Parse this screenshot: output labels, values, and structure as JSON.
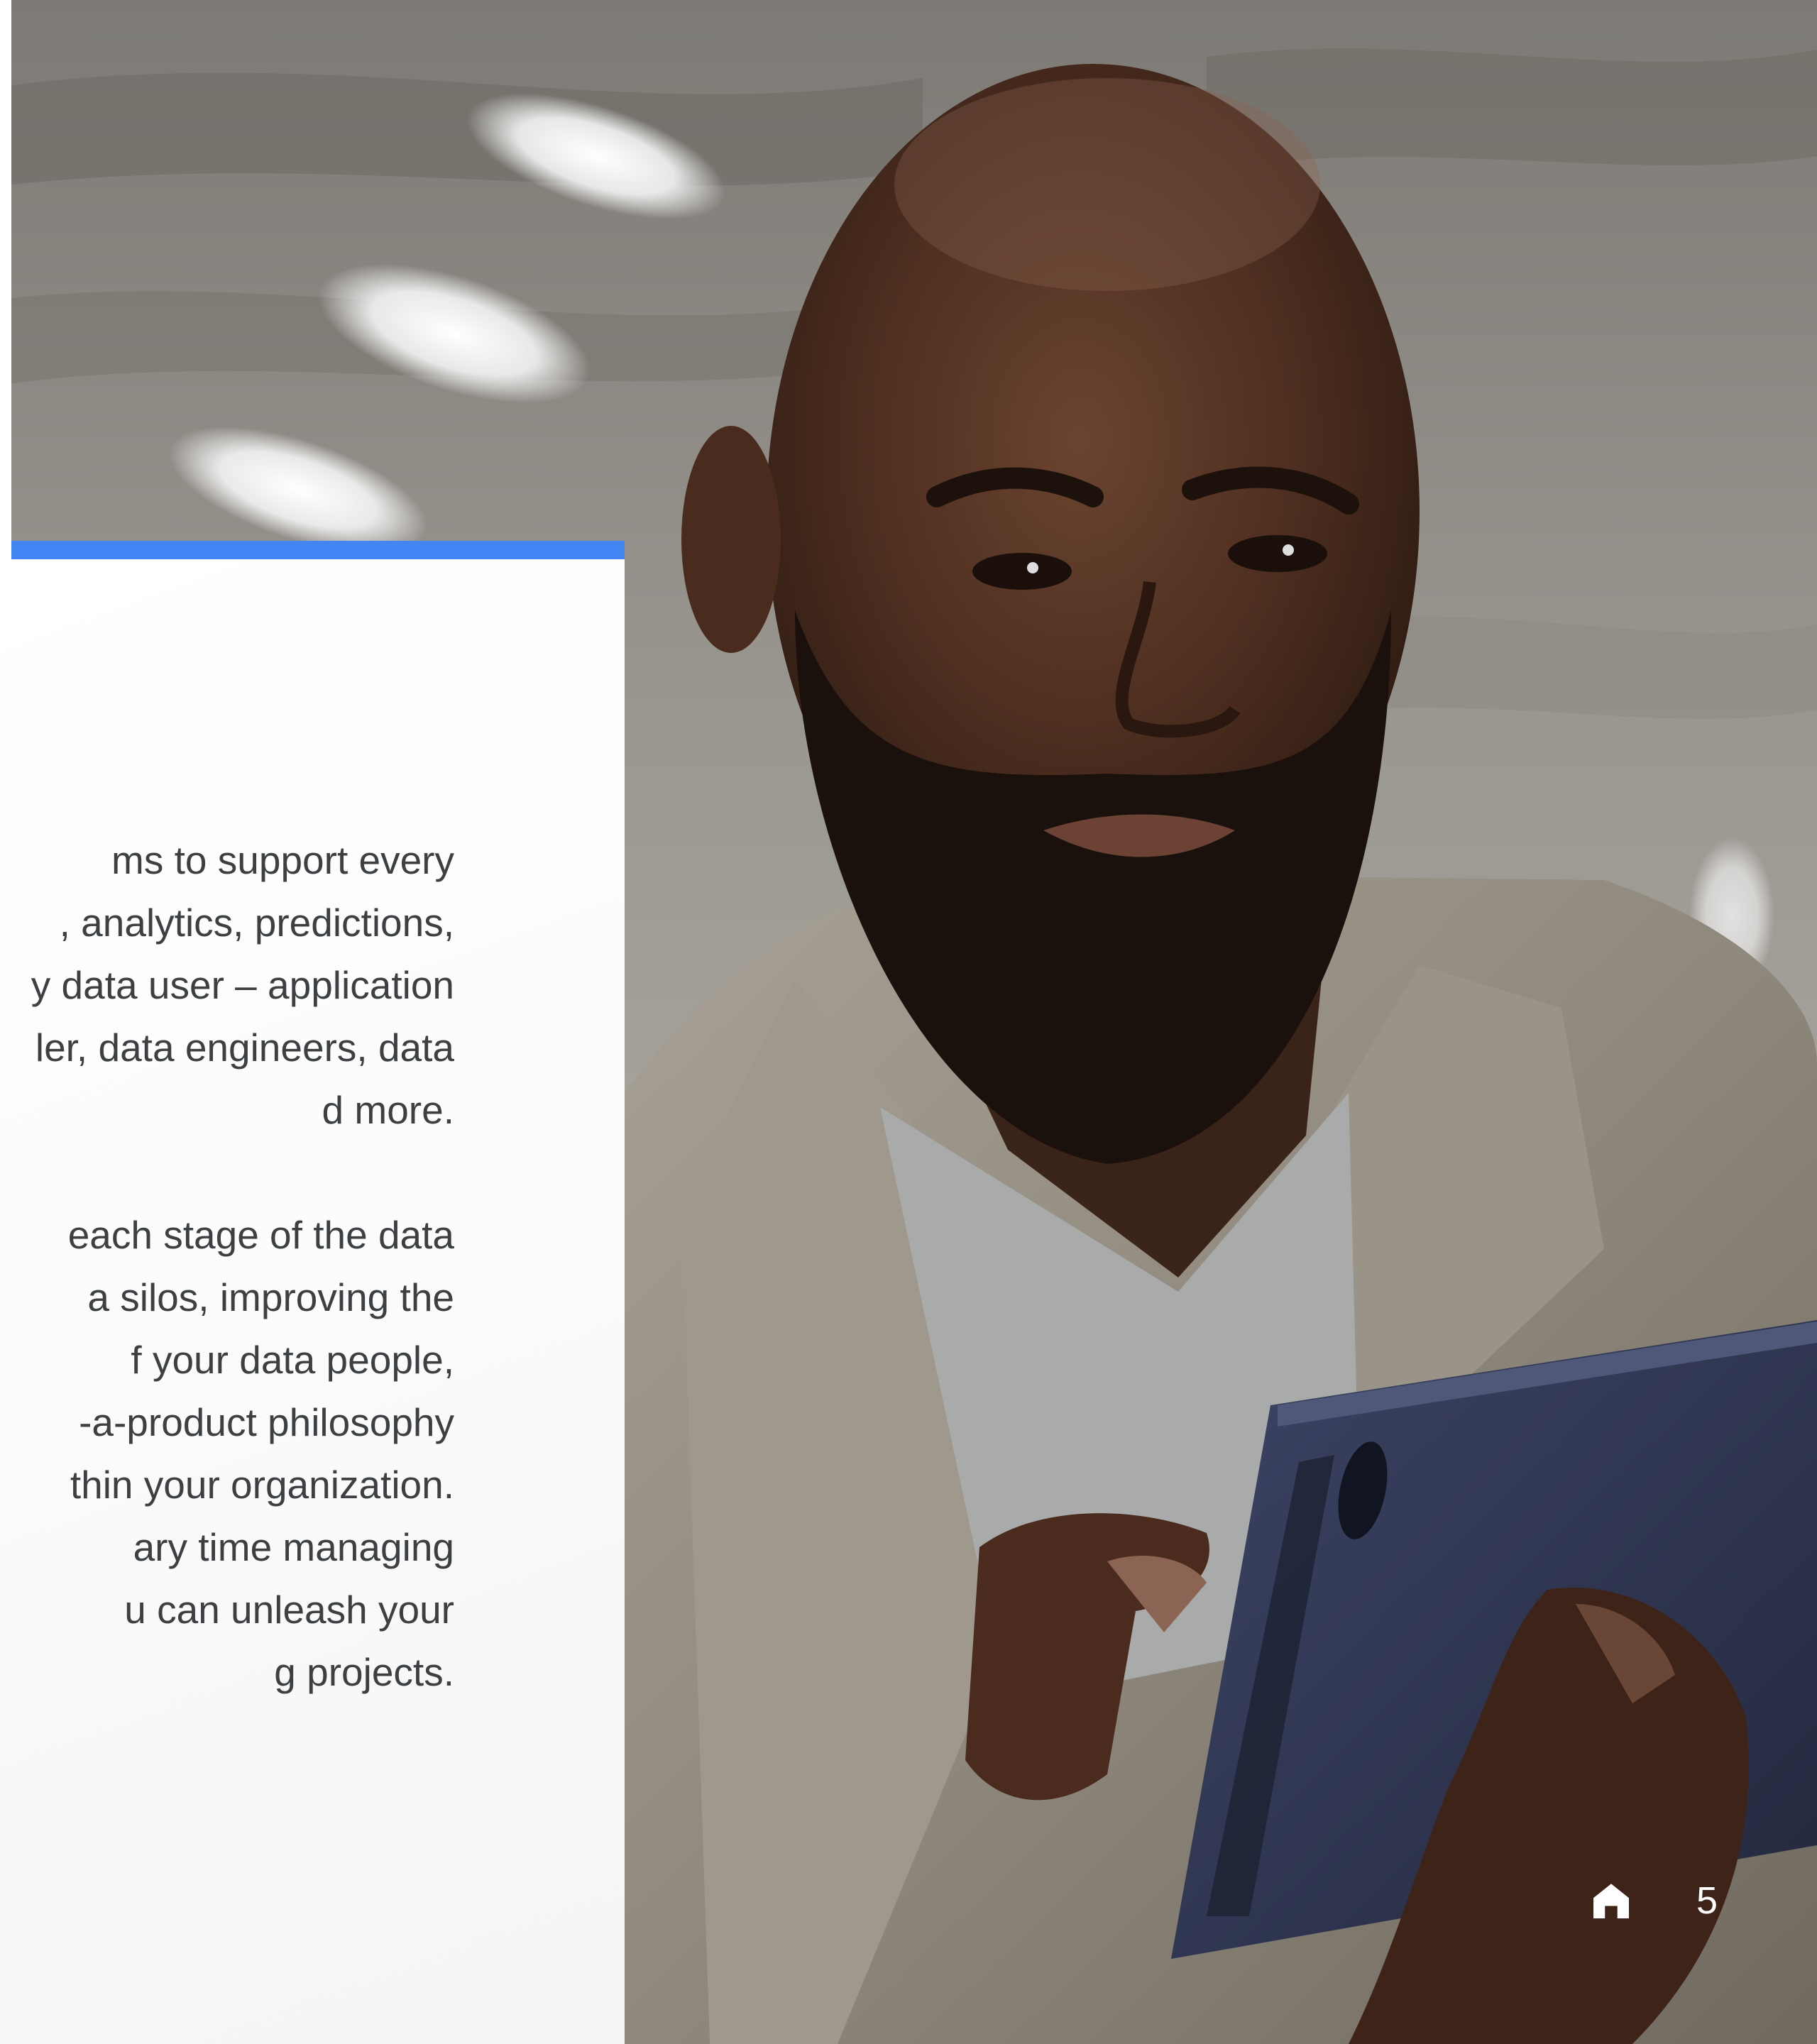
{
  "body_text": {
    "para1": [
      "ms to support every",
      ", analytics, predictions,",
      "y data user – application",
      "ler, data engineers, data",
      "d more."
    ],
    "para2": [
      "each stage of the data",
      "a silos, improving the",
      "f your data people,",
      "-a-product philosophy",
      "thin your organization.",
      "ary time managing",
      "u can unleash your",
      "g projects."
    ]
  },
  "footer": {
    "home_icon": "home-icon",
    "page_number": "5"
  },
  "colors": {
    "accent_bar": "#4285f4",
    "body_text": "#3c4043",
    "footer_text": "#ffffff"
  }
}
